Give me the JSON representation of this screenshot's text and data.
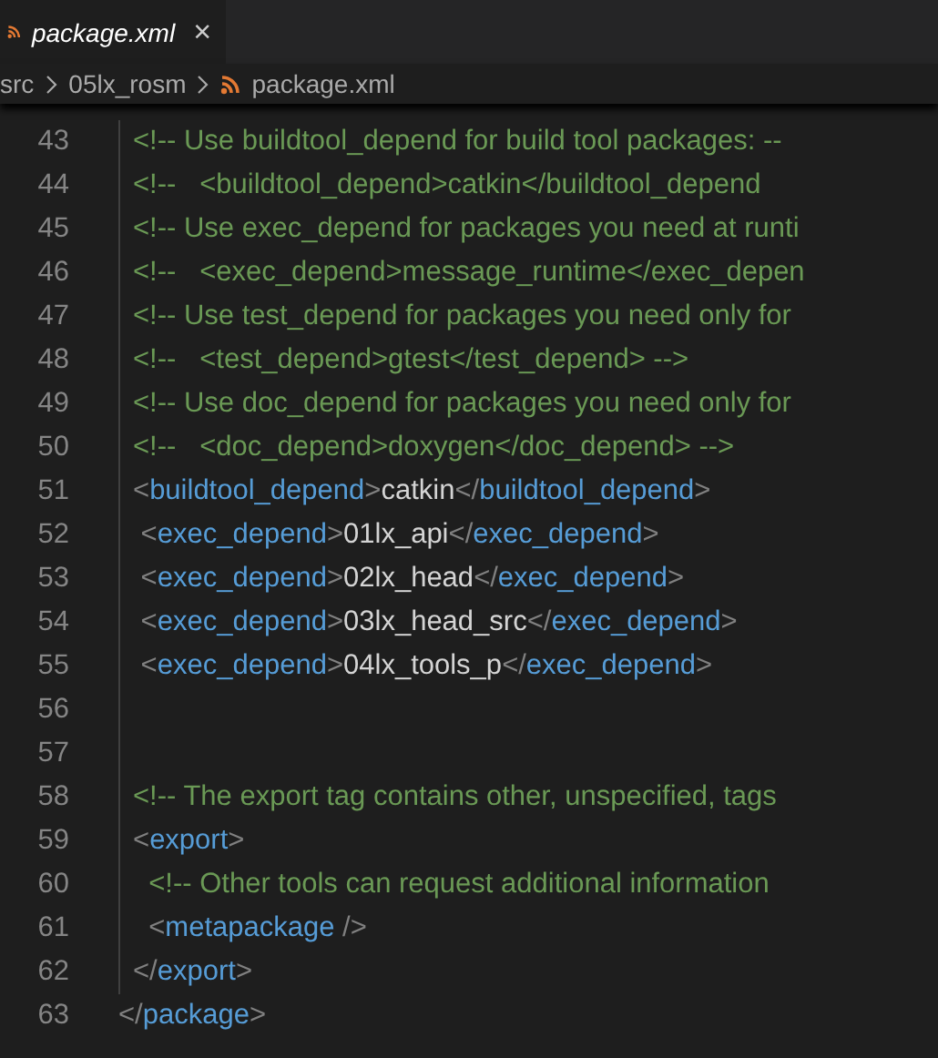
{
  "tabs": [
    {
      "label": "package.xml",
      "close": "×",
      "selected": true
    }
  ],
  "breadcrumb": [
    "src",
    "05lx_rosm",
    "package.xml"
  ],
  "lines": [
    {
      "number": "43",
      "segments": [
        {
          "kind": "comment",
          "text": "<!-- Use buildtool_depend for build tool packages: --"
        }
      ]
    },
    {
      "number": "44",
      "segments": [
        {
          "kind": "comment",
          "text": "<!--   <buildtool_depend>catkin</buildtool_depend"
        }
      ]
    },
    {
      "number": "45",
      "segments": [
        {
          "kind": "comment",
          "text": "<!-- Use exec_depend for packages you need at runti"
        }
      ]
    },
    {
      "number": "46",
      "segments": [
        {
          "kind": "comment",
          "text": "<!--   <exec_depend>message_runtime</exec_depen"
        }
      ]
    },
    {
      "number": "47",
      "segments": [
        {
          "kind": "comment",
          "text": "<!-- Use test_depend for packages you need only for"
        }
      ]
    },
    {
      "number": "48",
      "segments": [
        {
          "kind": "comment",
          "text": "<!--   <test_depend>gtest</test_depend> -->"
        }
      ]
    },
    {
      "number": "49",
      "segments": [
        {
          "kind": "comment",
          "text": "<!-- Use doc_depend for packages you need only for"
        }
      ]
    },
    {
      "number": "50",
      "segments": [
        {
          "kind": "comment",
          "text": "<!--   <doc_depend>doxygen</doc_depend> -->"
        }
      ]
    },
    {
      "number": "51",
      "segments": [
        {
          "kind": "bracket",
          "text": "<"
        },
        {
          "kind": "tag",
          "text": "buildtool_depend"
        },
        {
          "kind": "bracket",
          "text": ">"
        },
        {
          "kind": "text",
          "text": "catkin"
        },
        {
          "kind": "bracket",
          "text": "</"
        },
        {
          "kind": "tag",
          "text": "buildtool_depend"
        },
        {
          "kind": "bracket",
          "text": ">"
        }
      ]
    },
    {
      "number": "52",
      "segments": [
        {
          "kind": "bracket",
          "text": " <"
        },
        {
          "kind": "tag",
          "text": "exec_depend"
        },
        {
          "kind": "bracket",
          "text": ">"
        },
        {
          "kind": "text",
          "text": "01lx_api"
        },
        {
          "kind": "bracket",
          "text": "</"
        },
        {
          "kind": "tag",
          "text": "exec_depend"
        },
        {
          "kind": "bracket",
          "text": ">"
        }
      ]
    },
    {
      "number": "53",
      "segments": [
        {
          "kind": "bracket",
          "text": " <"
        },
        {
          "kind": "tag",
          "text": "exec_depend"
        },
        {
          "kind": "bracket",
          "text": ">"
        },
        {
          "kind": "text",
          "text": "02lx_head"
        },
        {
          "kind": "bracket",
          "text": "</"
        },
        {
          "kind": "tag",
          "text": "exec_depend"
        },
        {
          "kind": "bracket",
          "text": ">"
        }
      ]
    },
    {
      "number": "54",
      "segments": [
        {
          "kind": "bracket",
          "text": " <"
        },
        {
          "kind": "tag",
          "text": "exec_depend"
        },
        {
          "kind": "bracket",
          "text": ">"
        },
        {
          "kind": "text",
          "text": "03lx_head_src"
        },
        {
          "kind": "bracket",
          "text": "</"
        },
        {
          "kind": "tag",
          "text": "exec_depend"
        },
        {
          "kind": "bracket",
          "text": ">"
        }
      ]
    },
    {
      "number": "55",
      "segments": [
        {
          "kind": "bracket",
          "text": " <"
        },
        {
          "kind": "tag",
          "text": "exec_depend"
        },
        {
          "kind": "bracket",
          "text": ">"
        },
        {
          "kind": "text",
          "text": "04lx_tools_p"
        },
        {
          "kind": "bracket",
          "text": "</"
        },
        {
          "kind": "tag",
          "text": "exec_depend"
        },
        {
          "kind": "bracket",
          "text": ">"
        }
      ]
    },
    {
      "number": "56"
    },
    {
      "number": "57"
    },
    {
      "number": "58",
      "segments": [
        {
          "kind": "comment",
          "text": "<!-- The export tag contains other, unspecified, tags"
        }
      ]
    },
    {
      "number": "59",
      "segments": [
        {
          "kind": "bracket",
          "text": "<"
        },
        {
          "kind": "tag",
          "text": "export"
        },
        {
          "kind": "bracket",
          "text": ">"
        }
      ]
    },
    {
      "number": "60",
      "segments": [
        {
          "kind": "comment",
          "text": "  <!-- Other tools can request additional information"
        }
      ]
    },
    {
      "number": "61",
      "segments": [
        {
          "kind": "bracket",
          "text": "  <"
        },
        {
          "kind": "tag",
          "text": "metapackage"
        },
        {
          "kind": "bracket",
          "text": " />"
        }
      ]
    },
    {
      "number": "62",
      "segments": [
        {
          "kind": "bracket",
          "text": "</"
        },
        {
          "kind": "tag",
          "text": "export"
        },
        {
          "kind": "bracket",
          "text": ">"
        }
      ]
    },
    {
      "number": "63",
      "outer": true,
      "segments": [
        {
          "kind": "bracket",
          "text": "</"
        },
        {
          "kind": "tag",
          "text": "package"
        },
        {
          "kind": "bracket",
          "text": ">"
        }
      ]
    }
  ]
}
